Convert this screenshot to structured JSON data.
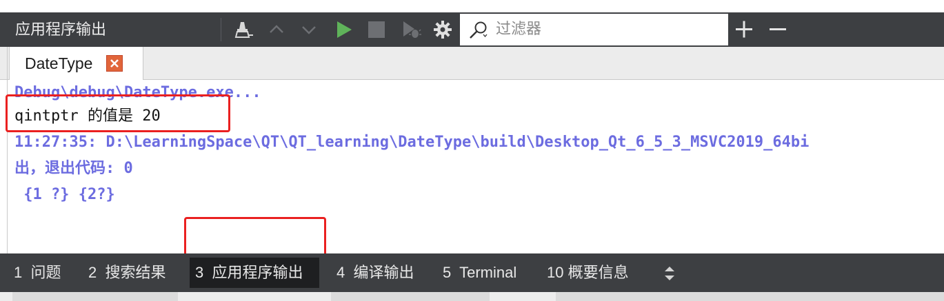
{
  "panel": {
    "title": "应用程序输出",
    "filter_placeholder": "过滤器"
  },
  "toolbar": {
    "icons": [
      "clean-icon",
      "previous-icon",
      "next-icon",
      "run-icon",
      "stop-icon",
      "debug-icon",
      "settings-icon",
      "zoom-in-icon",
      "zoom-out-icon"
    ],
    "run_color": "#5fb35a"
  },
  "tab": {
    "label": "DateType",
    "close_color": "#e1653a"
  },
  "output": {
    "lines": [
      "Debug\\debug\\DateType.exe...",
      "qintptr 的值是 20",
      "11:27:35: D:\\LearningSpace\\QT\\QT_learning\\DateType\\build\\Desktop_Qt_6_5_3_MSVC2019_64bi",
      "出，退出代码: 0",
      " {1 ?} {2?}"
    ],
    "info_color": "#6c6ce0"
  },
  "output_panes": [
    {
      "num": "1",
      "label": "问题"
    },
    {
      "num": "2",
      "label": "搜索结果"
    },
    {
      "num": "3",
      "label": "应用程序输出",
      "active": true
    },
    {
      "num": "4",
      "label": "编译输出"
    },
    {
      "num": "5",
      "label": "Terminal"
    },
    {
      "num": "10",
      "label": "概要信息"
    }
  ]
}
